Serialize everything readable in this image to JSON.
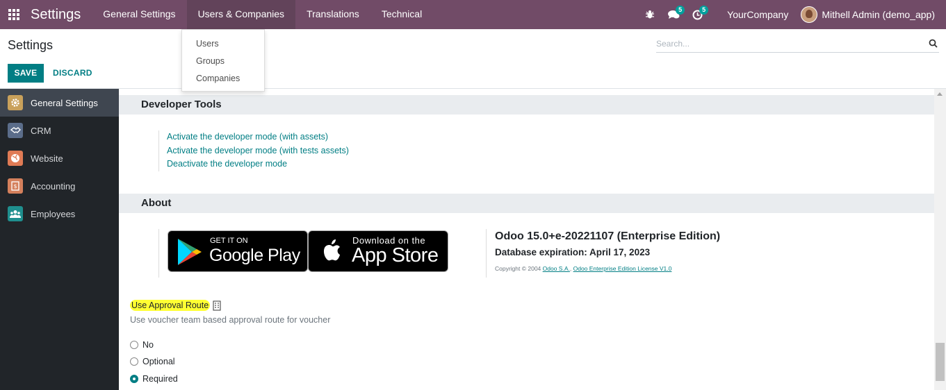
{
  "navbar": {
    "app_title": "Settings",
    "menus": [
      {
        "label": "General Settings"
      },
      {
        "label": "Users & Companies"
      },
      {
        "label": "Translations"
      },
      {
        "label": "Technical"
      }
    ],
    "messages_count": "5",
    "activities_count": "5",
    "company": "YourCompany",
    "user": "Mithell Admin (demo_app)",
    "accent_color": "#714B67"
  },
  "dropdown": {
    "items": [
      "Users",
      "Groups",
      "Companies"
    ]
  },
  "control_panel": {
    "breadcrumb": "Settings",
    "save_label": "SAVE",
    "discard_label": "DISCARD",
    "search_placeholder": "Search..."
  },
  "sidebar": {
    "items": [
      {
        "label": "General Settings",
        "icon": "gear-icon",
        "color": "#c9a15b"
      },
      {
        "label": "CRM",
        "icon": "handshake-icon",
        "color": "#5b6d8a"
      },
      {
        "label": "Website",
        "icon": "globe-icon",
        "color": "#e07b55"
      },
      {
        "label": "Accounting",
        "icon": "invoice-icon",
        "color": "#d4805c"
      },
      {
        "label": "Employees",
        "icon": "people-icon",
        "color": "#1f8f8e"
      }
    ]
  },
  "developer_tools": {
    "title": "Developer Tools",
    "links": [
      "Activate the developer mode (with assets)",
      "Activate the developer mode (with tests assets)",
      "Deactivate the developer mode"
    ]
  },
  "about": {
    "title": "About",
    "google_play_small": "GET IT ON",
    "google_play_big": "Google Play",
    "app_store_small": "Download on the",
    "app_store_big": "App Store",
    "version": "Odoo 15.0+e-20221107 (Enterprise Edition)",
    "expiry": "Database expiration: April 17, 2023",
    "copyright_prefix": "Copyright © 2004",
    "copyright_link1": "Odoo S.A.",
    "copyright_link2": "Odoo Enterprise Edition License V1.0"
  },
  "approval": {
    "label": "Use Approval Route",
    "description": "Use voucher team based approval route for voucher",
    "options": [
      {
        "label": "No",
        "checked": false
      },
      {
        "label": "Optional",
        "checked": false
      },
      {
        "label": "Required",
        "checked": true
      }
    ]
  }
}
